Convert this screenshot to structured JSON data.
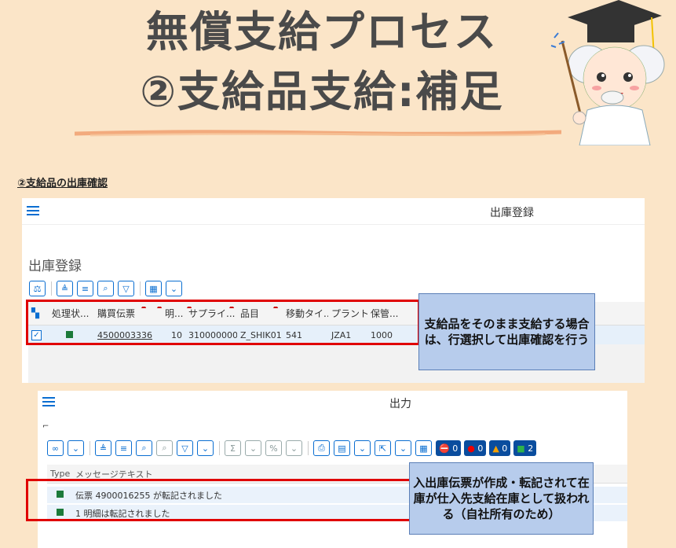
{
  "slide": {
    "title_line1": "無償支給プロセス",
    "title_line2": "②支給品支給:補足",
    "section_heading": "②支給品の出庫確認"
  },
  "panel1": {
    "header_title": "出庫登録",
    "subtitle": "出庫登録",
    "columns": [
      "処理状...",
      "購買伝票",
      "明...",
      "サプライ...",
      "品目",
      "移動タイ...",
      "プラント",
      "保管..."
    ],
    "row": {
      "status_color": "#1c7a3a",
      "purchase_doc": "4500003336",
      "item": "10",
      "supplier": "3100000001",
      "material": "Z_SHIK01",
      "movement_type": "541",
      "plant": "JZA1",
      "storage": "1000"
    },
    "callout": "支給品をそのまま支給する場合は、行選択して出庫確認を行う"
  },
  "panel2": {
    "header_title": "出力",
    "counters": {
      "stop": "0",
      "error": "0",
      "warning": "0",
      "success": "2"
    },
    "columns": [
      "Type",
      "メッセージテキスト"
    ],
    "messages": [
      {
        "type_color": "#1c7a3a",
        "text": "伝票 4900016255 が転記されました"
      },
      {
        "type_color": "#1c7a3a",
        "text": "1 明細は転記されました"
      }
    ],
    "callout": "入出庫伝票が作成・転記されて在庫が仕入先支給在庫として扱われる（自社所有のため）"
  },
  "colors": {
    "background": "#fbe5c8",
    "accent_blue": "#0a6ed1",
    "highlight_red": "#e00000",
    "callout_fill": "#b7ccec"
  }
}
